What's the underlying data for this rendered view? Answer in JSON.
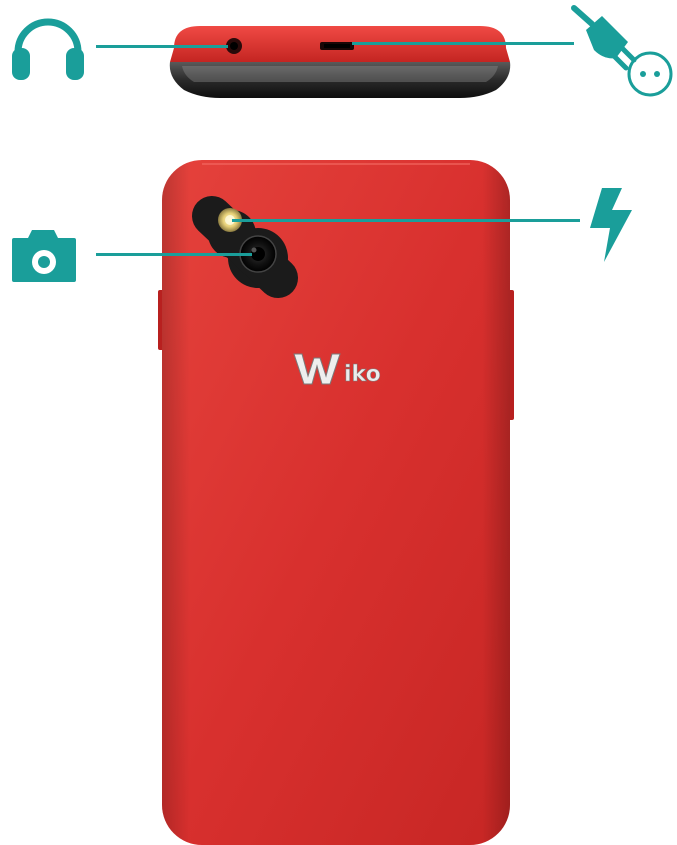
{
  "brand": {
    "logo_text": "Wiko"
  },
  "colors": {
    "accent_teal": "#1a9e9a",
    "phone_red": "#d8302e",
    "phone_red_dark": "#b8201f",
    "camera_black": "#1b1b1b"
  },
  "callouts": [
    {
      "feature": "headphone-jack",
      "icon": "headphones-icon"
    },
    {
      "feature": "micro-usb-charging-port",
      "icon": "plug-socket-icon"
    },
    {
      "feature": "rear-camera",
      "icon": "camera-icon"
    },
    {
      "feature": "flash",
      "icon": "lightning-bolt-icon"
    }
  ]
}
